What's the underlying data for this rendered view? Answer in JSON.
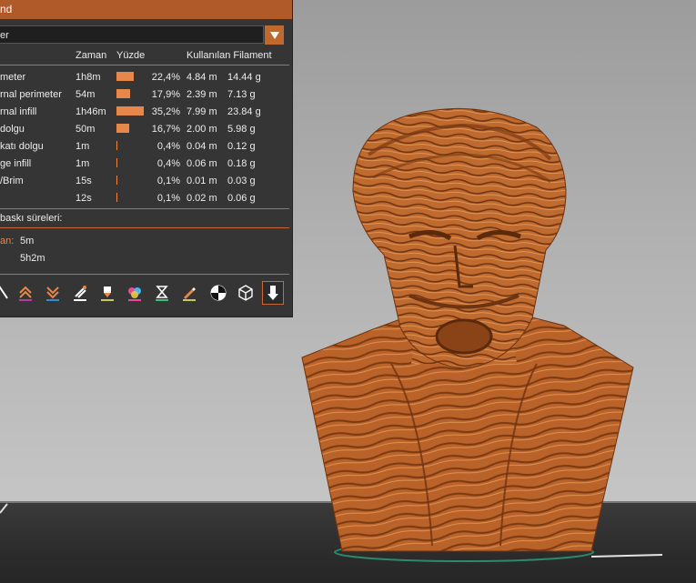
{
  "panel": {
    "title": "nd",
    "combo_value": "er",
    "headers": {
      "time": "Zaman",
      "percent": "Yüzde",
      "used_filament": "Kullanılan Filament"
    },
    "rows": [
      {
        "label": "meter",
        "time": "1h8m",
        "percent": "22,4%",
        "percent_value": 22.4,
        "length": "4.84 m",
        "weight": "14.44 g"
      },
      {
        "label": "rnal perimeter",
        "time": "54m",
        "percent": "17,9%",
        "percent_value": 17.9,
        "length": "2.39 m",
        "weight": "7.13 g"
      },
      {
        "label": "rnal infill",
        "time": "1h46m",
        "percent": "35,2%",
        "percent_value": 35.2,
        "length": "7.99 m",
        "weight": "23.84 g"
      },
      {
        "label": "dolgu",
        "time": "50m",
        "percent": "16,7%",
        "percent_value": 16.7,
        "length": "2.00 m",
        "weight": "5.98 g"
      },
      {
        "label": "katı dolgu",
        "time": "1m",
        "percent": "0,4%",
        "percent_value": 0.4,
        "length": "0.04 m",
        "weight": "0.12 g"
      },
      {
        "label": "ge infill",
        "time": "1m",
        "percent": "0,4%",
        "percent_value": 0.4,
        "length": "0.06 m",
        "weight": "0.18 g"
      },
      {
        "label": "/Brim",
        "time": "15s",
        "percent": "0,1%",
        "percent_value": 0.1,
        "length": "0.01 m",
        "weight": "0.03 g"
      },
      {
        "label": "",
        "time": "12s",
        "percent": "0,1%",
        "percent_value": 0.1,
        "length": "0.02 m",
        "weight": "0.06 g"
      }
    ],
    "section_title": "baskı süreleri:",
    "times": [
      {
        "label": "an:",
        "value": "5m"
      },
      {
        "label": "",
        "value": "5h2m"
      }
    ],
    "toolbar": [
      {
        "icon": "seam-icon"
      },
      {
        "icon": "retractions-icon"
      },
      {
        "icon": "deretractions-icon"
      },
      {
        "icon": "wipe-icon"
      },
      {
        "icon": "tool-change-icon"
      },
      {
        "icon": "color-change-icon"
      },
      {
        "icon": "pause-print-icon"
      },
      {
        "icon": "custom-gcode-icon"
      },
      {
        "icon": "center-of-gravity-icon"
      },
      {
        "icon": "shells-icon"
      },
      {
        "icon": "tool-marker-icon"
      }
    ]
  },
  "colors": {
    "accent": "#c0692e",
    "title_bar": "#b05a2a",
    "panel_bg": "#353535",
    "model": "#b9622a",
    "bar": "#e8874a"
  }
}
